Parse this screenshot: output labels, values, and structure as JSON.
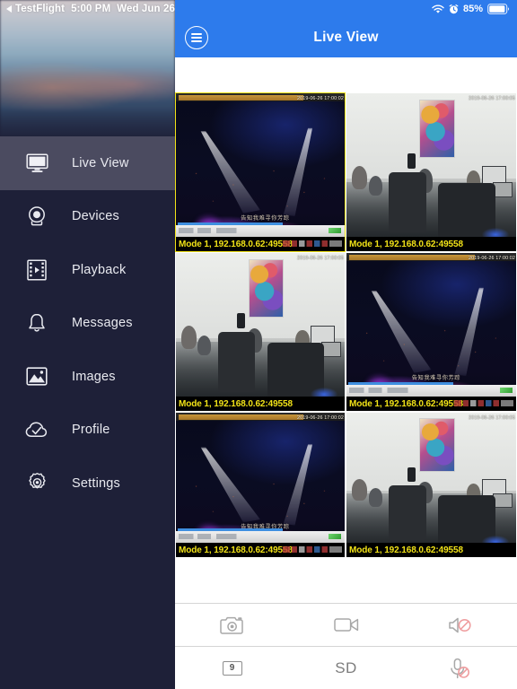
{
  "status_bar": {
    "back_app": "TestFlight",
    "time": "5:00 PM",
    "date": "Wed Jun 26",
    "battery_percent": "85%",
    "icons": [
      "wifi-icon",
      "alarm-icon",
      "battery-icon"
    ]
  },
  "sidebar": {
    "selected_index": 0,
    "items": [
      {
        "label": "Live View",
        "icon": "monitor-icon"
      },
      {
        "label": "Devices",
        "icon": "camera-dome-icon"
      },
      {
        "label": "Playback",
        "icon": "film-strip-icon"
      },
      {
        "label": "Messages",
        "icon": "bell-icon"
      },
      {
        "label": "Images",
        "icon": "picture-icon"
      },
      {
        "label": "Profile",
        "icon": "cloud-check-icon"
      },
      {
        "label": "Settings",
        "icon": "gear-icon"
      }
    ]
  },
  "navbar": {
    "title": "Live View",
    "menu_icon": "hamburger-menu-icon"
  },
  "grid": {
    "columns": 2,
    "rows": 3,
    "tiles": [
      {
        "scene": "concert",
        "label": "Mode 1, 192.168.0.62:49558",
        "timestamp": "2019-06-26 17:00:02",
        "selected": true
      },
      {
        "scene": "office",
        "label": "Mode 1, 192.168.0.62:49558",
        "timestamp": "2019-06-26 17:00:05",
        "selected": false
      },
      {
        "scene": "office",
        "label": "Mode 1, 192.168.0.62:49558",
        "timestamp": "2019-06-26 17:00:05",
        "selected": false
      },
      {
        "scene": "concert",
        "label": "Mode 1, 192.168.0.62:49558",
        "timestamp": "2019-06-26 17:00:02",
        "selected": false
      },
      {
        "scene": "concert",
        "label": "Mode 1, 192.168.0.62:49558",
        "timestamp": "2019-06-26 17:00:02",
        "selected": false
      },
      {
        "scene": "office",
        "label": "Mode 1, 192.168.0.62:49558",
        "timestamp": "2019-06-26 17:00:05",
        "selected": false
      }
    ]
  },
  "toolbar": {
    "row1": [
      {
        "name": "snapshot-button",
        "icon": "camera-icon",
        "label": ""
      },
      {
        "name": "record-button",
        "icon": "video-camera-icon",
        "label": ""
      },
      {
        "name": "audio-mute-button",
        "icon": "speaker-muted-icon",
        "label": ""
      }
    ],
    "row2": [
      {
        "name": "layout-button",
        "icon": "grid-count-icon",
        "label": "9"
      },
      {
        "name": "quality-button",
        "icon": "",
        "label": "SD"
      },
      {
        "name": "mic-mute-button",
        "icon": "microphone-muted-icon",
        "label": ""
      }
    ]
  },
  "colors": {
    "accent_blue": "#2d7bec",
    "sidebar_bg": "#1e2038",
    "sidebar_selected": "#4b4b60",
    "tile_label_yellow": "#f2e317",
    "tile_selected_border": "#f2e317",
    "mute_red": "#e8565a",
    "toolbar_icon_gray": "#8d8d8d"
  }
}
